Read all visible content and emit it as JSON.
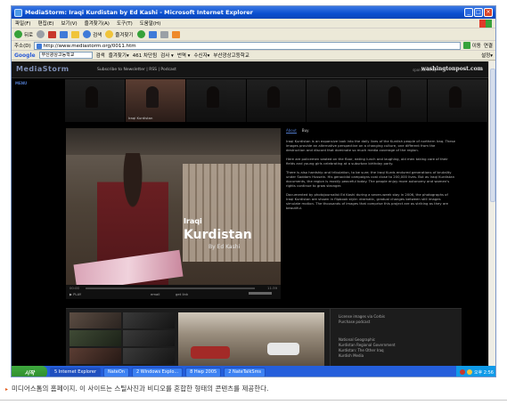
{
  "window": {
    "title": "MediaStorm: Iraqi Kurdistan by Ed Kashi - Microsoft Internet Explorer",
    "controls": [
      "_",
      "□",
      "×"
    ]
  },
  "menubar": [
    "파일(F)",
    "편집(E)",
    "보기(V)",
    "즐겨찾기(A)",
    "도구(T)",
    "도움말(H)"
  ],
  "toolbar": {
    "back": "뒤로",
    "search": "검색",
    "favorites": "즐겨찾기"
  },
  "address": {
    "label": "주소(D)",
    "url": "http://www.mediastorm.org/0011.htm",
    "go": "이동",
    "links": "연결"
  },
  "googlebar": {
    "logo": "Google",
    "search_value": "부산광상고등학교",
    "search_label": "검색",
    "items": [
      "즐겨찾기▾",
      "461 차단됨",
      "검사 ▾",
      "번역 ▾",
      "수신자▾",
      "부산광상고등학교"
    ],
    "settings": "설정▾"
  },
  "site": {
    "logo": "MediaStorm",
    "top_links": "Subscribe to Newsletter | RSS | Podcast",
    "sponsor": "sponsored by",
    "sponsor_brand": "washingtonpost.com",
    "menu": "MENU",
    "thumbs": [
      "",
      "Iraqi Kurdistan",
      "",
      "",
      "",
      "",
      ""
    ],
    "video": {
      "title_small": "Iraqi",
      "title_big": "Kurdistan",
      "byline": "By Ed Kashi",
      "time_elapsed": "00:00",
      "time_total": "11:39",
      "play": "▶ PLAY",
      "email": "email",
      "embed": "get link"
    },
    "article": {
      "tab_about": "About",
      "tab_buy": "Buy",
      "p1": "Iraqi Kurdistan is an expansive look into the daily lives of the Kurdish people of northern Iraq. These images provide an alternative perspective on a changing culture, one different from the destruction and discord that dominate so much media coverage of the region.",
      "p2": "Here are policemen seated on the floor, eating lunch and laughing, old men taking care of their fields and young girls celebrating at a suburban birthday party.",
      "p3": "There is also hardship and tribulation, to be sure; the Iraqi Kurds endured generations of brutality under Saddam Hussein. His genocidal campaigns cost close to 200,000 lives. But as Iraqi Kurdistan documents, the region is mostly peaceful today. The people enjoy more autonomy and women's rights continue to grow stronger.",
      "p4": "Documented by photojournalist Ed Kashi during a seven-week stay in 2006, the photographs of Iraqi Kurdistan are shown in flipbook style: dramatic, gradual changes between still images simulate motion. The thousands of images that comprise this project are as striking as they are beautiful."
    },
    "lower_links": [
      "License images via Corbis",
      "Purchase podcast",
      "National Geographic",
      "Kurdistan Regional Government",
      "Kurdistan: The Other Iraq",
      "Kurdish Media"
    ]
  },
  "taskbar": {
    "start": "시작",
    "tasks": [
      "5 Internet Explorer",
      "NateOn",
      "2 Windows Explo...",
      "8 Hwp 2005",
      "2 NateTalkSms"
    ],
    "clock": "오후 2:56"
  },
  "caption": "미디어스톰의 홈페이지. 이 사이트는 스틸사진과 비디오를 혼합한 형태의 콘텐츠를 제공한다."
}
